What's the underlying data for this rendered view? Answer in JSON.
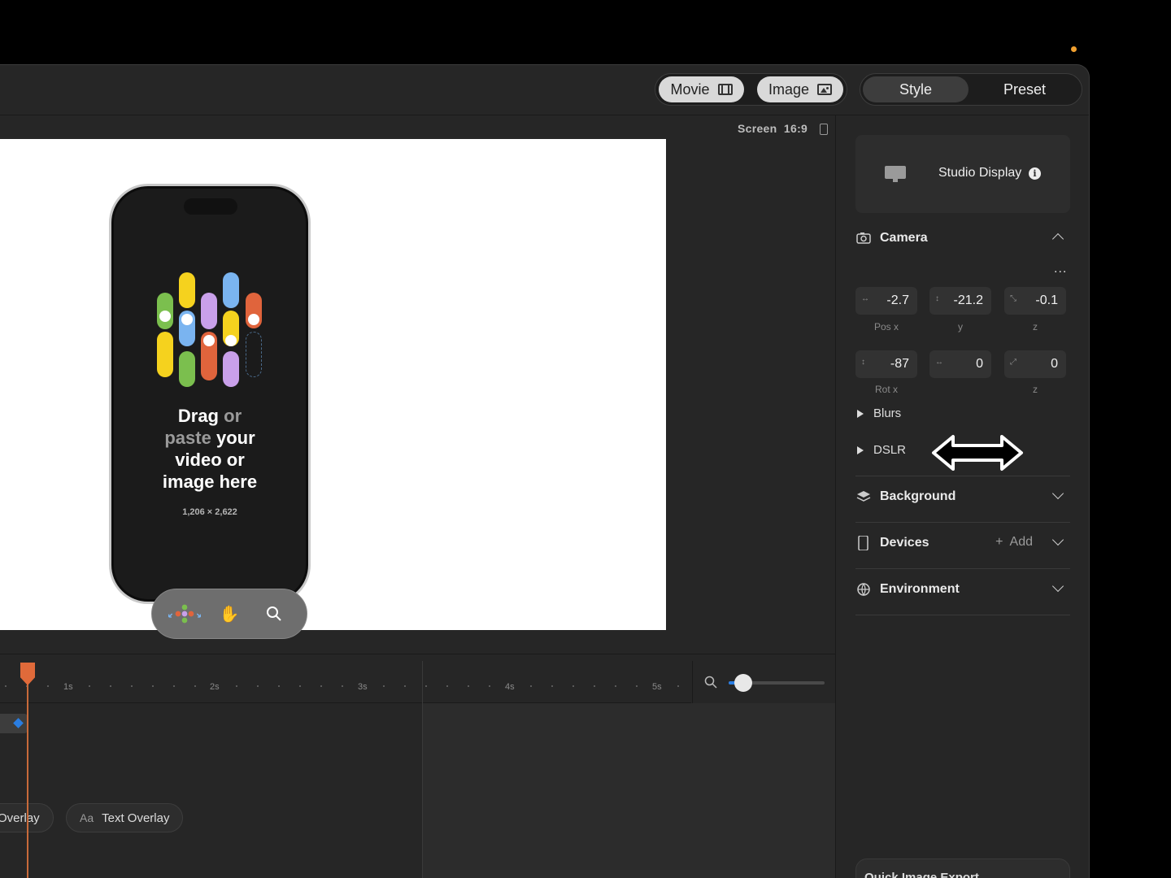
{
  "header": {
    "mode_tabs": [
      {
        "label": "Movie",
        "icon": "film-icon"
      },
      {
        "label": "Image",
        "icon": "image-icon"
      }
    ],
    "panel_tabs": [
      {
        "label": "Style",
        "active": true
      },
      {
        "label": "Preset",
        "active": false
      }
    ]
  },
  "canvas": {
    "screen_label": "Screen",
    "aspect": "16:9",
    "drop_line1_bold": "Drag",
    "drop_line1_dim": "or",
    "drop_line2_dim": "paste",
    "drop_line2_bold": "your",
    "drop_line3": "video or",
    "drop_line4": "image here",
    "drop_size": "1,206 × 2,622",
    "colors": {
      "yellow": "#f5d21e",
      "green": "#7bbf4e",
      "blue": "#7ab4f0",
      "purple": "#c9a0ea",
      "orange": "#e0643c"
    }
  },
  "sidebar": {
    "display_name": "Studio Display",
    "camera": {
      "title": "Camera",
      "more": "...",
      "pos": {
        "x": "-2.7",
        "y": "-21.2",
        "z": "-0.1",
        "label_x": "Pos x",
        "label_y": "y",
        "label_z": "z"
      },
      "rot": {
        "x": "-87",
        "y": "0",
        "z": "0",
        "label_x": "Rot x",
        "label_z": "z"
      },
      "blurs": "Blurs",
      "dslr": "DSLR"
    },
    "background": "Background",
    "devices": "Devices",
    "devices_add": "Add",
    "environment": "Environment",
    "quick_export": "Quick Image Export"
  },
  "timeline": {
    "ticks": [
      "1s",
      "2s",
      "3s",
      "4s",
      "5s"
    ],
    "chips": [
      {
        "prefix": "",
        "label": "Overlay"
      },
      {
        "prefix": "Aa",
        "label": "Text Overlay"
      }
    ],
    "zoom_level": 0.15,
    "accent": "#2a7de1",
    "playhead_color": "#e06a3a"
  }
}
